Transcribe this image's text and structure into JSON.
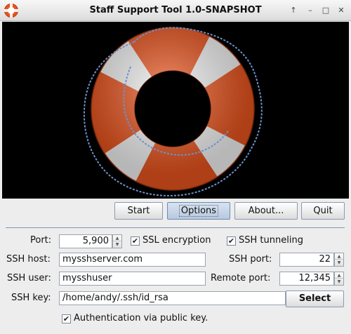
{
  "window": {
    "title": "Staff Support Tool 1.0-SNAPSHOT",
    "controls": {
      "up": "↑",
      "minimize": "–",
      "maximize": "□",
      "close": "✕"
    }
  },
  "toolbar": {
    "start_label": "Start",
    "options_label": "Options",
    "about_label": "About...",
    "quit_label": "Quit"
  },
  "options": {
    "port_label": "Port:",
    "port_value": "5,900",
    "ssl_label": "SSL encryption",
    "ssl_checked": true,
    "ssh_tunnel_label": "SSH tunneling",
    "ssh_tunnel_checked": true,
    "ssh_host_label": "SSH host:",
    "ssh_host_value": "mysshserver.com",
    "ssh_port_label": "SSH port:",
    "ssh_port_value": "22",
    "ssh_user_label": "SSH user:",
    "ssh_user_value": "mysshuser",
    "remote_port_label": "Remote port:",
    "remote_port_value": "12,345",
    "ssh_key_label": "SSH key:",
    "ssh_key_value": "/home/andy/.ssh/id_rsa",
    "select_label": "Select",
    "pubkey_auth_label": "Authentication via public key.",
    "pubkey_auth_checked": true
  },
  "icons": {
    "check": "✔",
    "spin_up": "▲",
    "spin_down": "▼"
  },
  "colors": {
    "buoy_orange": "#e9541e",
    "banner_bg": "#000000",
    "separator": "#7f97b2"
  }
}
